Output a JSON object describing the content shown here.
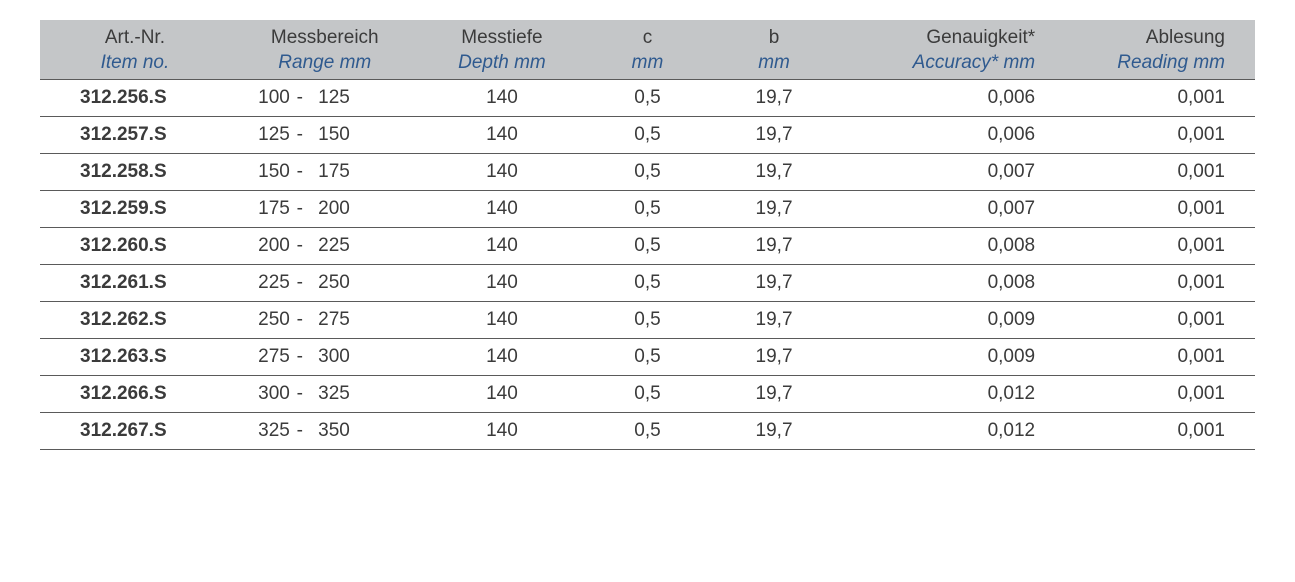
{
  "chart_data": {
    "type": "table",
    "headers": [
      {
        "de": "Art.-Nr.",
        "en": "Item no."
      },
      {
        "de": "Messbereich",
        "en": "Range mm"
      },
      {
        "de": "Messtiefe",
        "en": "Depth mm"
      },
      {
        "de": "c",
        "en": "mm"
      },
      {
        "de": "b",
        "en": "mm"
      },
      {
        "de": "Genauigkeit*",
        "en": "Accuracy* mm"
      },
      {
        "de": "Ablesung",
        "en": "Reading mm"
      }
    ],
    "rows": [
      {
        "art": "312.256.S",
        "range_from": "100",
        "range_to": "125",
        "depth": "140",
        "c": "0,5",
        "b": "19,7",
        "accuracy": "0,006",
        "reading": "0,001"
      },
      {
        "art": "312.257.S",
        "range_from": "125",
        "range_to": "150",
        "depth": "140",
        "c": "0,5",
        "b": "19,7",
        "accuracy": "0,006",
        "reading": "0,001"
      },
      {
        "art": "312.258.S",
        "range_from": "150",
        "range_to": "175",
        "depth": "140",
        "c": "0,5",
        "b": "19,7",
        "accuracy": "0,007",
        "reading": "0,001"
      },
      {
        "art": "312.259.S",
        "range_from": "175",
        "range_to": "200",
        "depth": "140",
        "c": "0,5",
        "b": "19,7",
        "accuracy": "0,007",
        "reading": "0,001"
      },
      {
        "art": "312.260.S",
        "range_from": "200",
        "range_to": "225",
        "depth": "140",
        "c": "0,5",
        "b": "19,7",
        "accuracy": "0,008",
        "reading": "0,001"
      },
      {
        "art": "312.261.S",
        "range_from": "225",
        "range_to": "250",
        "depth": "140",
        "c": "0,5",
        "b": "19,7",
        "accuracy": "0,008",
        "reading": "0,001"
      },
      {
        "art": "312.262.S",
        "range_from": "250",
        "range_to": "275",
        "depth": "140",
        "c": "0,5",
        "b": "19,7",
        "accuracy": "0,009",
        "reading": "0,001"
      },
      {
        "art": "312.263.S",
        "range_from": "275",
        "range_to": "300",
        "depth": "140",
        "c": "0,5",
        "b": "19,7",
        "accuracy": "0,009",
        "reading": "0,001"
      },
      {
        "art": "312.266.S",
        "range_from": "300",
        "range_to": "325",
        "depth": "140",
        "c": "0,5",
        "b": "19,7",
        "accuracy": "0,012",
        "reading": "0,001"
      },
      {
        "art": "312.267.S",
        "range_from": "325",
        "range_to": "350",
        "depth": "140",
        "c": "0,5",
        "b": "19,7",
        "accuracy": "0,012",
        "reading": "0,001"
      }
    ]
  }
}
